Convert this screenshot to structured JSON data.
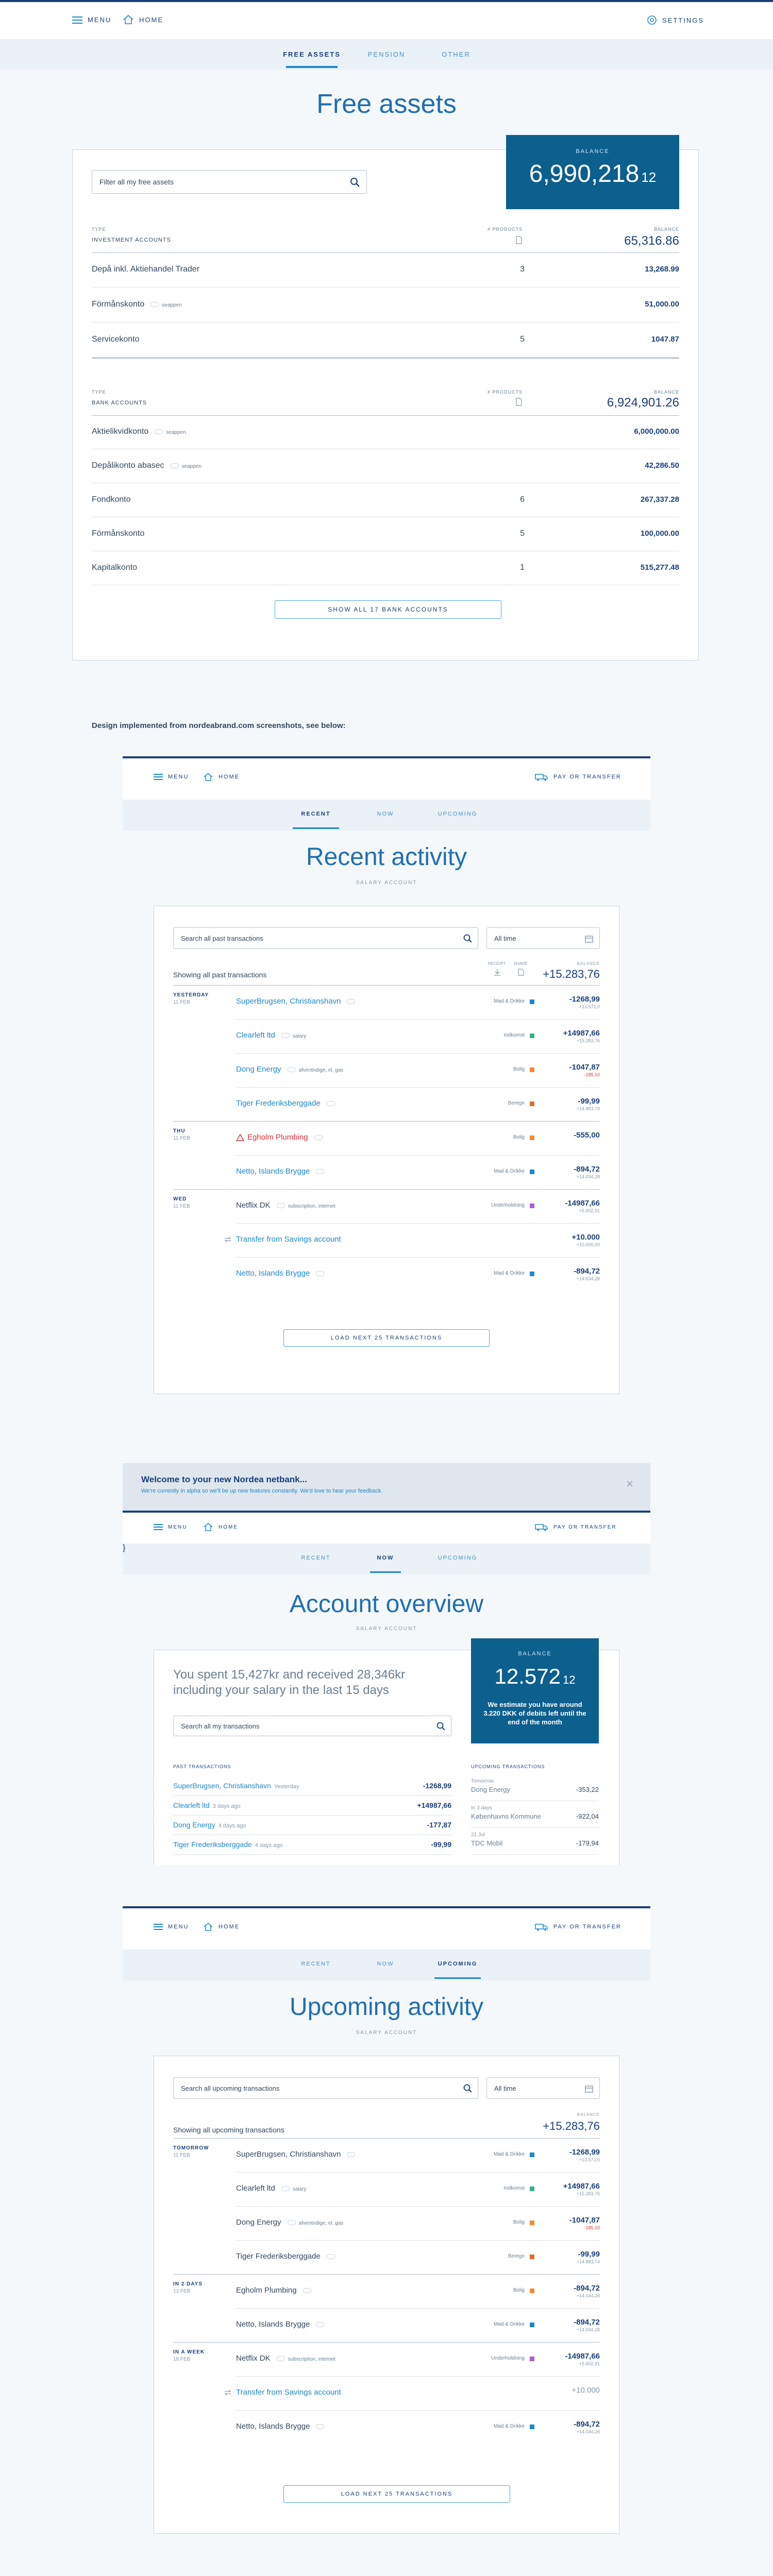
{
  "nav": {
    "menu": "MENU",
    "home": "HOME",
    "settings": "SETTINGS",
    "pay_transfer": "PAY OR TRANSFER"
  },
  "free_assets": {
    "tabs": [
      "FREE ASSETS",
      "PENSION",
      "OTHER"
    ],
    "title": "Free assets",
    "balance_label": "BALANCE",
    "balance_main": "6,990,218",
    "balance_dec": "12",
    "filter_placeholder": "Filter all my free assets",
    "type_label": "TYPE",
    "products_label": "# PRODUCTS",
    "balance_col_label": "BALANCE",
    "investment": {
      "group": "INVESTMENT ACCOUNTS",
      "total": "65,316.86",
      "rows": [
        {
          "name": "Depå inkl. Aktiehandel Trader",
          "tag": "",
          "count": "3",
          "amount": "13,268.99"
        },
        {
          "name": "Förmånskonto",
          "tag": "seappen",
          "count": "",
          "amount": "51,000.00"
        },
        {
          "name": "Servicekonto",
          "tag": "",
          "count": "5",
          "amount": "1047.87"
        }
      ]
    },
    "bank": {
      "group": "BANK ACCOUNTS",
      "total": "6,924,901.26",
      "rows": [
        {
          "name": "Aktielikvidkonto",
          "tag": "seappen",
          "count": "",
          "amount": "6,000,000.00"
        },
        {
          "name": "Depålikonto abasec",
          "tag": "seappen",
          "count": "",
          "amount": "42,286.50"
        },
        {
          "name": "Fondkonto",
          "tag": "",
          "count": "6",
          "amount": "267,337.28"
        },
        {
          "name": "Förmånskonto",
          "tag": "",
          "count": "5",
          "amount": "100,000.00"
        },
        {
          "name": "Kapitalkonto",
          "tag": "",
          "count": "1",
          "amount": "515,277.48"
        }
      ]
    },
    "show_all": "SHOW ALL 17 BANK ACCOUNTS"
  },
  "caption": "Design implemented from nordeabrand.com screenshots, see below:",
  "recent": {
    "tabs": [
      "RECENT",
      "NOW",
      "UPCOMING"
    ],
    "title": "Recent activity",
    "subtitle": "SALARY ACCOUNT",
    "search": "Search all past transactions",
    "period": "All time",
    "showing": "Showing all past transactions",
    "balance_label": "BALANCE",
    "balance": "+15.283,76",
    "col_receipt": "RECEIPT",
    "col_share": "SHARE",
    "load_more": "LOAD NEXT 25 TRANSACTIONS",
    "transactions": [
      {
        "day": "YESTERDAY",
        "date": "11 FEB",
        "name": "SuperBrugsen, Christianshavn",
        "tag": "",
        "cat": "Mad & Drikke",
        "col": "#1f87c9",
        "amt": "-1268,99",
        "sub": "+13.571,0",
        "style": ""
      },
      {
        "day": "",
        "date": "",
        "name": "Clearleft ltd",
        "tag": "salary",
        "cat": "Indkomst",
        "col": "#3bb08f",
        "amt": "+14987,66",
        "sub": "+15.283,76",
        "style": ""
      },
      {
        "day": "",
        "date": "",
        "name": "Dong Energy",
        "tag": "afventndige, el, gas",
        "cat": "Bolig",
        "col": "#f28b30",
        "amt": "-1047,87",
        "sub": "-185,10",
        "style": "red-sub"
      },
      {
        "day": "",
        "date": "",
        "name": "Tiger Frederiksberggade",
        "tag": "",
        "cat": "Beregn",
        "col": "#e66a2c",
        "amt": "-99,99",
        "sub": "+14.883,74",
        "style": ""
      },
      {
        "day": "THU",
        "date": "11 FEB",
        "name": "Egholm Plumbing",
        "tag": "",
        "cat": "Bolig",
        "col": "#f28b30",
        "amt": "-555,00",
        "sub": "",
        "style": "warn"
      },
      {
        "day": "",
        "date": "",
        "name": "Netto, Islands Brygge",
        "tag": "",
        "cat": "Mad & Drikke",
        "col": "#1f87c9",
        "amt": "-894,72",
        "sub": "+14.034,28",
        "style": ""
      },
      {
        "day": "WED",
        "date": "11 FEB",
        "name": "Netflix DK",
        "tag": "subscription, internet",
        "cat": "Underholdning",
        "col": "#b05ad1",
        "amt": "-14987,66",
        "sub": "+5.602,91",
        "style": "dark"
      },
      {
        "day": "",
        "date": "",
        "name": "Transfer from Savings account",
        "tag": "",
        "cat": "",
        "col": "",
        "amt": "+10.000",
        "sub": "+10.000,00",
        "style": "transfer"
      },
      {
        "day": "",
        "date": "",
        "name": "Netto, Islands Brygge",
        "tag": "",
        "cat": "Mad & Drikke",
        "col": "#1f87c9",
        "amt": "-894,72",
        "sub": "+14.034,28",
        "style": ""
      }
    ]
  },
  "overview": {
    "banner_title": "Welcome to your new Nordea netbank...",
    "banner_text": "We're currently in alpha so we'll be up new features constantly. We'd love to hear your feedback.",
    "tabs": [
      "RECENT",
      "NOW",
      "UPCOMING"
    ],
    "title": "Account overview",
    "subtitle": "SALARY ACCOUNT",
    "summary": "You spent 15,427kr and received 28,346kr including your salary in the last 15 days",
    "search": "Search all my transactions",
    "balance_label": "BALANCE",
    "balance_main": "12.572",
    "balance_dec": "12",
    "estimate": "We estimate you have around 3.220 DKK of debits left until the end of the month",
    "past_label": "PAST TRANSACTIONS",
    "upcoming_label": "UPCOMING TRANSACTIONS",
    "past": [
      {
        "name": "SuperBrugsen, Christianshavn",
        "when": "Yesterday",
        "amt": "-1268,99"
      },
      {
        "name": "Clearleft ltd",
        "when": "3 days ago",
        "amt": "+14987,66"
      },
      {
        "name": "Dong Energy",
        "when": "4 days ago",
        "amt": "-177,87"
      },
      {
        "name": "Tiger Frederiksberggade",
        "when": "4 days ago",
        "amt": "-99,99"
      }
    ],
    "upcoming": [
      {
        "when": "Tomorrow",
        "name": "Dong Energy",
        "amt": "-353,22"
      },
      {
        "when": "In 3 days",
        "name": "Københavns Kommune",
        "amt": "-922,04"
      },
      {
        "when": "21 Jul",
        "name": "TDC Mobil",
        "amt": "-179,94"
      }
    ]
  },
  "upcoming": {
    "tabs": [
      "RECENT",
      "NOW",
      "UPCOMING"
    ],
    "title": "Upcoming activity",
    "subtitle": "SALARY ACCOUNT",
    "search": "Search all upcoming transactions",
    "period": "All time",
    "showing": "Showing all upcoming transactions",
    "balance_label": "BALANCE",
    "balance": "+15.283,76",
    "load_more": "LOAD NEXT 25 TRANSACTIONS",
    "transactions": [
      {
        "day": "TOMORROW",
        "date": "11 FEB",
        "name": "SuperBrugsen, Christianshavn",
        "tag": "",
        "cat": "Mad & Drikke",
        "col": "#1f87c9",
        "amt": "-1268,99",
        "sub": "+13.571,0",
        "style": "dark"
      },
      {
        "day": "",
        "date": "",
        "name": "Clearleft ltd",
        "tag": "salary",
        "cat": "Indkomst",
        "col": "#3bb08f",
        "amt": "+14987,66",
        "sub": "+15.283,76",
        "style": "dark"
      },
      {
        "day": "",
        "date": "",
        "name": "Dong Energy",
        "tag": "afventndige, el, gas",
        "cat": "Bolig",
        "col": "#f28b30",
        "amt": "-1047,87",
        "sub": "-185,10",
        "style": "dark red-sub"
      },
      {
        "day": "",
        "date": "",
        "name": "Tiger Frederiksberggade",
        "tag": "",
        "cat": "Beregn",
        "col": "#e66a2c",
        "amt": "-99,99",
        "sub": "+14.883,74",
        "style": "dark"
      },
      {
        "day": "IN 2 DAYS",
        "date": "13 FEB",
        "name": "Egholm Plumbing",
        "tag": "",
        "cat": "Bolig",
        "col": "#f28b30",
        "amt": "-894,72",
        "sub": "+14.034,28",
        "style": "dark"
      },
      {
        "day": "",
        "date": "",
        "name": "Netto, Islands Brygge",
        "tag": "",
        "cat": "Mad & Drikke",
        "col": "#1f87c9",
        "amt": "-894,72",
        "sub": "+14.034,28",
        "style": "dark"
      },
      {
        "day": "IN A WEEK",
        "date": "18 FEB",
        "name": "Netflix DK",
        "tag": "subscription, internet",
        "cat": "Underholdning",
        "col": "#b05ad1",
        "amt": "-14987,66",
        "sub": "+5.602,91",
        "style": "dark"
      },
      {
        "day": "",
        "date": "",
        "name": "Transfer from Savings account",
        "tag": "",
        "cat": "",
        "col": "",
        "amt": "+10.000",
        "sub": "",
        "style": "transfer muted"
      },
      {
        "day": "",
        "date": "",
        "name": "Netto, Islands Brygge",
        "tag": "",
        "cat": "Mad & Drikke",
        "col": "#1f87c9",
        "amt": "-894,72",
        "sub": "+14.034,28",
        "style": "dark"
      }
    ]
  }
}
